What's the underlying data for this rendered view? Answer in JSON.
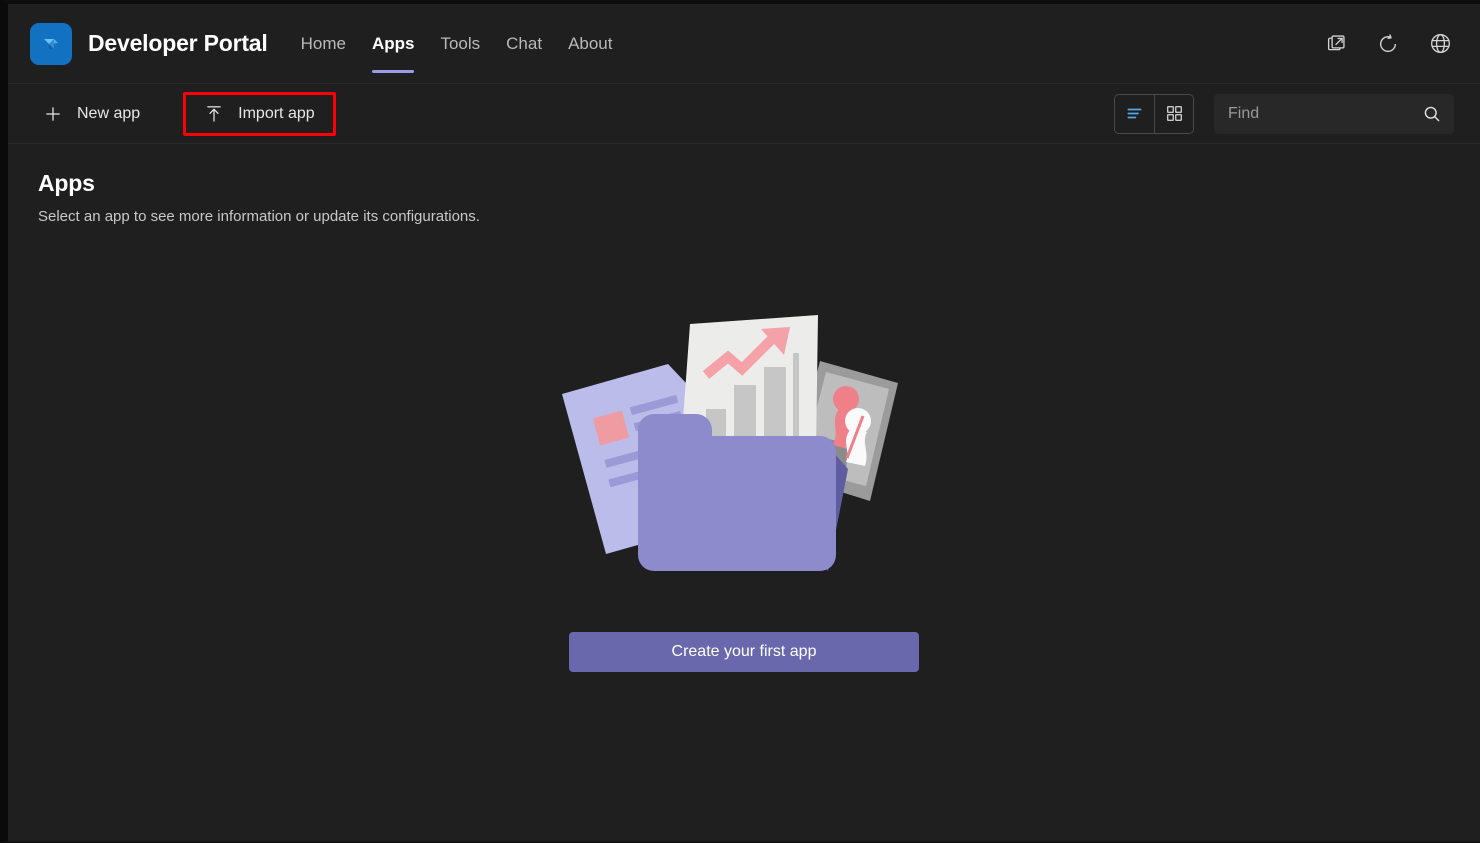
{
  "header": {
    "brand_title": "Developer Portal",
    "logo_icon": "developer-portal-logo",
    "nav": [
      {
        "label": "Home",
        "active": false
      },
      {
        "label": "Apps",
        "active": true
      },
      {
        "label": "Tools",
        "active": false
      },
      {
        "label": "Chat",
        "active": false
      },
      {
        "label": "About",
        "active": false
      }
    ],
    "actions": [
      {
        "icon": "open-in-new-icon",
        "name": "open-in-new-button"
      },
      {
        "icon": "refresh-icon",
        "name": "refresh-button"
      },
      {
        "icon": "globe-icon",
        "name": "globe-button"
      }
    ]
  },
  "toolbar": {
    "new_app_label": "New app",
    "new_app_icon": "plus-icon",
    "import_app_label": "Import app",
    "import_app_icon": "upload-icon",
    "import_app_highlighted": true,
    "highlight_color": "#fb0007",
    "view_list_icon": "list-view-icon",
    "view_grid_icon": "grid-view-icon",
    "view_active": "list",
    "search_placeholder": "Find",
    "search_value": "",
    "search_icon": "search-icon"
  },
  "main": {
    "title": "Apps",
    "subtitle": "Select an app to see more information or update its configurations.",
    "empty_state": {
      "illustration": "folder-with-documents-illustration",
      "cta_label": "Create your first app"
    }
  },
  "colors": {
    "background": "#1f1f1f",
    "logo_blue": "#1271c1",
    "accent_purple": "#9a9ae6",
    "cta_purple": "#6a68ac",
    "highlight_red": "#fb0007",
    "text_primary": "#ffffff",
    "text_secondary": "#c8c8c8"
  }
}
